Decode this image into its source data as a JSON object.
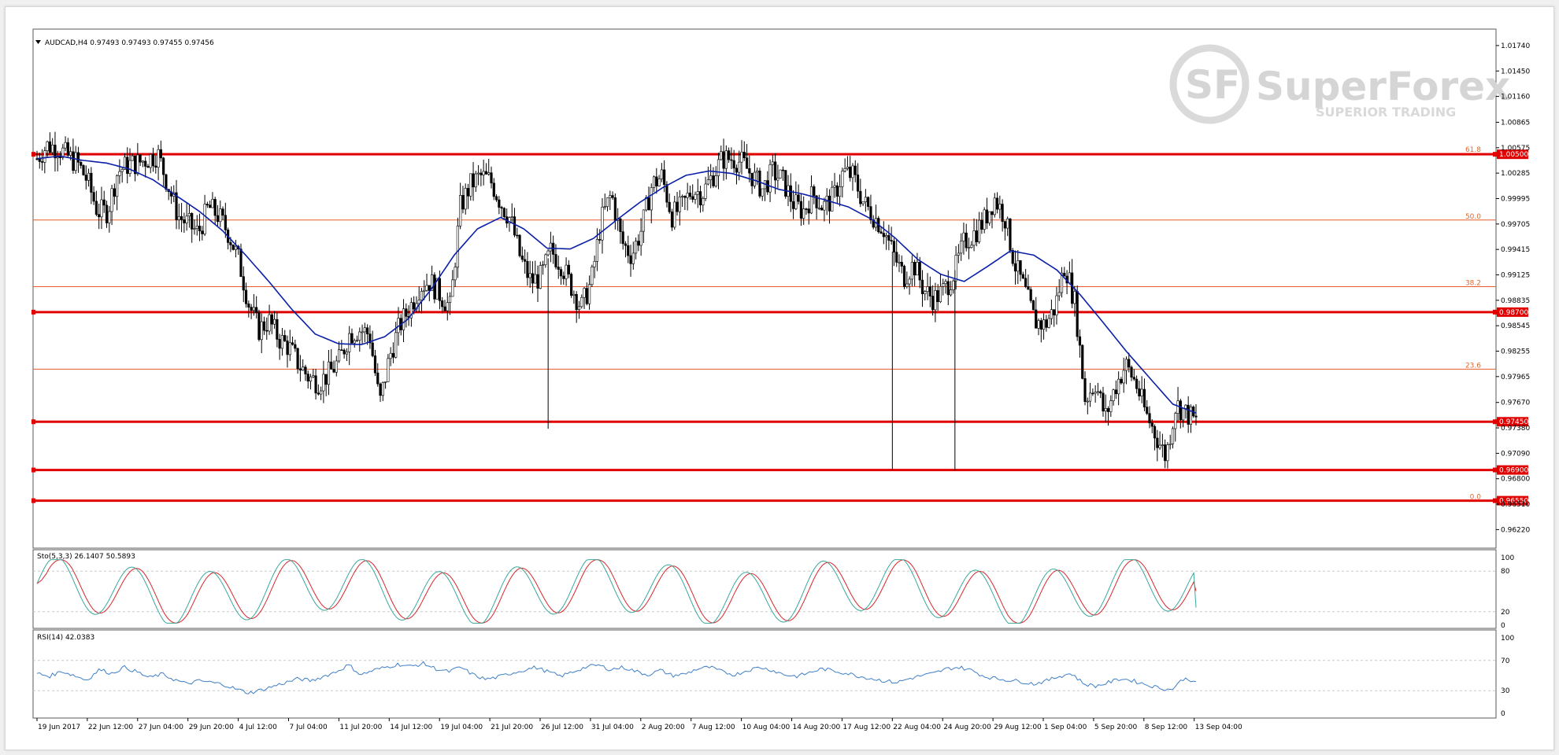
{
  "header": {
    "symbol_line": "AUDCAD,H4  0.97493 0.97493 0.97455 0.97456",
    "stoch_label": "Sto(5,3,3) 26.1407 50.5893",
    "rsi_label": "RSI(14) 42.0383"
  },
  "watermark": {
    "brand": "SuperForex",
    "tagline": "SUPERIOR TRADING",
    "logo": "SF"
  },
  "colors": {
    "ma": "#0a1fa8",
    "level_thick": "#e00000",
    "level_thin": "#e85a2a",
    "stoch_main": "#3aa89a",
    "stoch_signal": "#d9262a",
    "rsi": "#3e7fc7"
  },
  "chart_data": {
    "type": "candlestick",
    "title": "AUDCAD,H4",
    "ohlc_last": {
      "open": 0.97493,
      "high": 0.97493,
      "low": 0.97455,
      "close": 0.97456
    },
    "price_axis_ticks": [
      "1.01740",
      "1.01450",
      "1.01160",
      "1.00865",
      "1.00575",
      "1.00285",
      "0.99995",
      "0.99705",
      "0.99415",
      "0.99125",
      "0.98835",
      "0.98545",
      "0.98255",
      "0.97965",
      "0.97670",
      "0.97380",
      "0.97090",
      "0.96800",
      "0.96510",
      "0.96220"
    ],
    "ylim": [
      0.9608,
      1.0182
    ],
    "time_axis_ticks": [
      "19 Jun 2017",
      "22 Jun 12:00",
      "27 Jun 04:00",
      "29 Jun 20:00",
      "4 Jul 12:00",
      "7 Jul 04:00",
      "11 Jul 20:00",
      "14 Jul 12:00",
      "19 Jul 04:00",
      "21 Jul 20:00",
      "26 Jul 12:00",
      "31 Jul 04:00",
      "2 Aug 20:00",
      "7 Aug 12:00",
      "10 Aug 04:00",
      "14 Aug 20:00",
      "17 Aug 12:00",
      "22 Aug 04:00",
      "24 Aug 20:00",
      "29 Aug 12:00",
      "1 Sep 04:00",
      "5 Sep 20:00",
      "8 Sep 12:00",
      "13 Sep 04:00"
    ],
    "price_anchors": [
      1.0045,
      1.006,
      1.0058,
      1.0048,
      1.004,
      1.002,
      0.9985,
      0.9985,
      1.003,
      1.0038,
      1.004,
      1.0045,
      1.005,
      1.0015,
      0.998,
      0.997,
      0.996,
      0.999,
      0.998,
      0.996,
      0.993,
      0.988,
      0.985,
      0.986,
      0.984,
      0.983,
      0.981,
      0.9795,
      0.979,
      0.98,
      0.9815,
      0.9845,
      0.985,
      0.9845,
      0.9765,
      0.982,
      0.9855,
      0.9875,
      0.99,
      0.9905,
      0.989,
      0.9875,
      0.999,
      1.0015,
      1.0025,
      1.002,
      0.9995,
      0.9975,
      0.993,
      0.9905,
      0.991,
      0.994,
      0.9925,
      0.99,
      0.9875,
      0.9905,
      0.9975,
      1.0005,
      0.995,
      0.9935,
      0.9965,
      1.0015,
      1.0025,
      0.998,
      0.999,
      1.001,
      1.0005,
      1.0025,
      1.0045,
      1.0045,
      1.004,
      1.0025,
      1.001,
      1.003,
      1.002,
      0.9995,
      0.9985,
      1.0005,
      0.999,
      1.0,
      1.003,
      1.0025,
      0.9995,
      0.998,
      0.9965,
      0.9935,
      0.991,
      0.9925,
      0.9895,
      0.9885,
      0.9895,
      0.9915,
      0.995,
      0.996,
      0.9975,
      1.0,
      0.998,
      0.9925,
      0.9895,
      0.986,
      0.9855,
      0.9875,
      0.9925,
      0.988,
      0.977,
      0.979,
      0.975,
      0.9785,
      0.981,
      0.979,
      0.9755,
      0.973,
      0.9705,
      0.9765,
      0.9755,
      0.9745
    ],
    "moving_average_anchors": [
      1.0045,
      1.0048,
      1.0043,
      1.004,
      1.0033,
      1.0021,
      1.0003,
      0.9985,
      0.9963,
      0.9935,
      0.9905,
      0.9873,
      0.9845,
      0.9834,
      0.9833,
      0.9842,
      0.9862,
      0.9896,
      0.9935,
      0.9965,
      0.9978,
      0.9965,
      0.9943,
      0.9942,
      0.9954,
      0.9975,
      0.9995,
      1.0012,
      1.0026,
      1.0031,
      1.0028,
      1.002,
      1.001,
      1.0005,
      0.9998,
      0.999,
      0.9976,
      0.9955,
      0.993,
      0.9913,
      0.9905,
      0.9922,
      0.994,
      0.9935,
      0.9918,
      0.989,
      0.9858,
      0.9825,
      0.9795,
      0.9765,
      0.9755
    ],
    "fibonacci_levels": [
      {
        "label": "61.8",
        "price": 1.0051
      },
      {
        "label": "50.0",
        "price": 0.9975
      },
      {
        "label": "38.2",
        "price": 0.9899
      },
      {
        "label": "23.6",
        "price": 0.9805
      },
      {
        "label": "0.0",
        "price": 0.9655
      }
    ],
    "support_resistance": [
      {
        "price": 1.005,
        "label": "1.00500"
      },
      {
        "price": 0.987,
        "label": "0.98700"
      },
      {
        "price": 0.9745,
        "label": "0.97450"
      },
      {
        "price": 0.969,
        "label": "0.96900"
      },
      {
        "price": 0.9655,
        "label": "0.96550"
      }
    ],
    "stochastic": {
      "params": "5,3,3",
      "main": 26.1407,
      "signal": 50.5893,
      "levels": [
        20,
        80
      ],
      "axis_ticks": [
        "100",
        "80",
        "20",
        "0"
      ]
    },
    "rsi": {
      "period": 14,
      "value": 42.0383,
      "levels": [
        30,
        70
      ],
      "axis_ticks": [
        "100",
        "70",
        "30",
        "0"
      ],
      "anchors": [
        53,
        49,
        56,
        50,
        44,
        58,
        53,
        61,
        55,
        47,
        52,
        45,
        39,
        43,
        41,
        38,
        32,
        27,
        31,
        36,
        41,
        46,
        43,
        49,
        55,
        64,
        51,
        57,
        61,
        65,
        62,
        66,
        59,
        55,
        61,
        51,
        45,
        48,
        53,
        57,
        61,
        55,
        49,
        55,
        61,
        64,
        58,
        61,
        56,
        51,
        57,
        50,
        52,
        59,
        61,
        55,
        51,
        57,
        61,
        57,
        51,
        49,
        54,
        59,
        56,
        53,
        49,
        46,
        43,
        41,
        46,
        50,
        53,
        59,
        61,
        57,
        49,
        46,
        44,
        42,
        39,
        43,
        49,
        53,
        39,
        36,
        41,
        46,
        43,
        38,
        34,
        31,
        46,
        43
      ]
    }
  }
}
